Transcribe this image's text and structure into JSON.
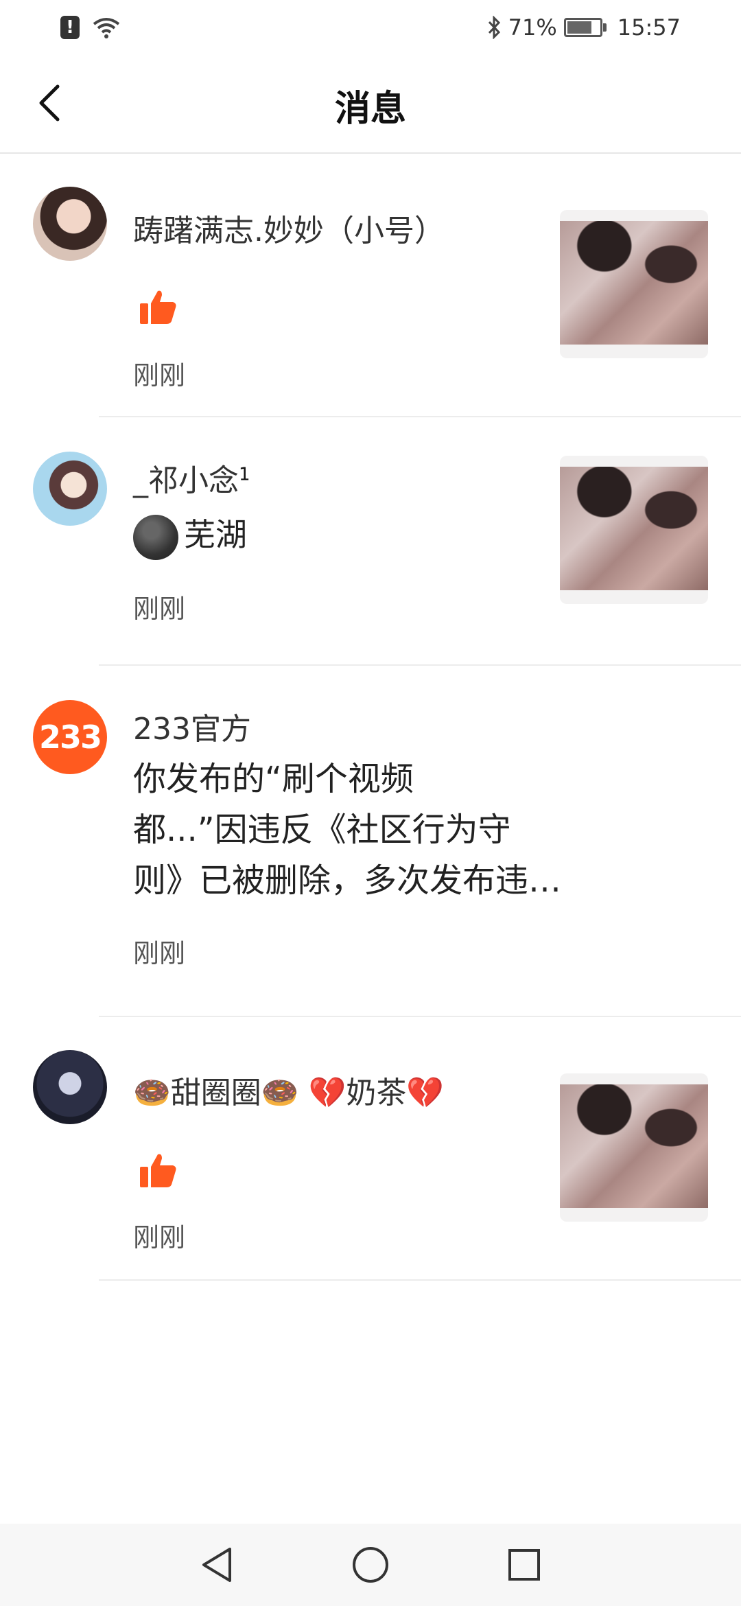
{
  "status_bar": {
    "battery": "71%",
    "battery_level": 0.71,
    "time": "15:57",
    "icons": [
      "alert-icon",
      "wifi-icon",
      "bluetooth-icon",
      "battery-icon"
    ]
  },
  "header": {
    "title": "消息",
    "back_icon": "chevron-left-icon"
  },
  "messages": [
    {
      "sender": "踌躇满志.妙妙（小号）",
      "content_type": "like",
      "content_icon": "thumbs-up-icon",
      "time": "刚刚",
      "has_thumbnail": true
    },
    {
      "sender": "_祁小念",
      "sender_badge": "1",
      "content_type": "text",
      "content_emoji": "moon-face-emoji",
      "content": "芜湖",
      "time": "刚刚",
      "has_thumbnail": true
    },
    {
      "sender": "233官方",
      "avatar_text": "233",
      "content_type": "text",
      "content_lines": [
        "你发布的“刷个视频",
        "都...”因违反《社区行为守",
        "则》已被删除，多次发布违…"
      ],
      "time": "刚刚",
      "has_thumbnail": false
    },
    {
      "sender": "🍩甜圈圈🍩 💔奶茶💔",
      "content_type": "like",
      "content_icon": "thumbs-up-icon",
      "time": "刚刚",
      "has_thumbnail": true
    }
  ],
  "nav_bar": {
    "buttons": [
      "back-triangle-icon",
      "home-circle-icon",
      "recents-square-icon"
    ]
  },
  "colors": {
    "accent": "#ff5a1f",
    "divider": "#ececec"
  }
}
